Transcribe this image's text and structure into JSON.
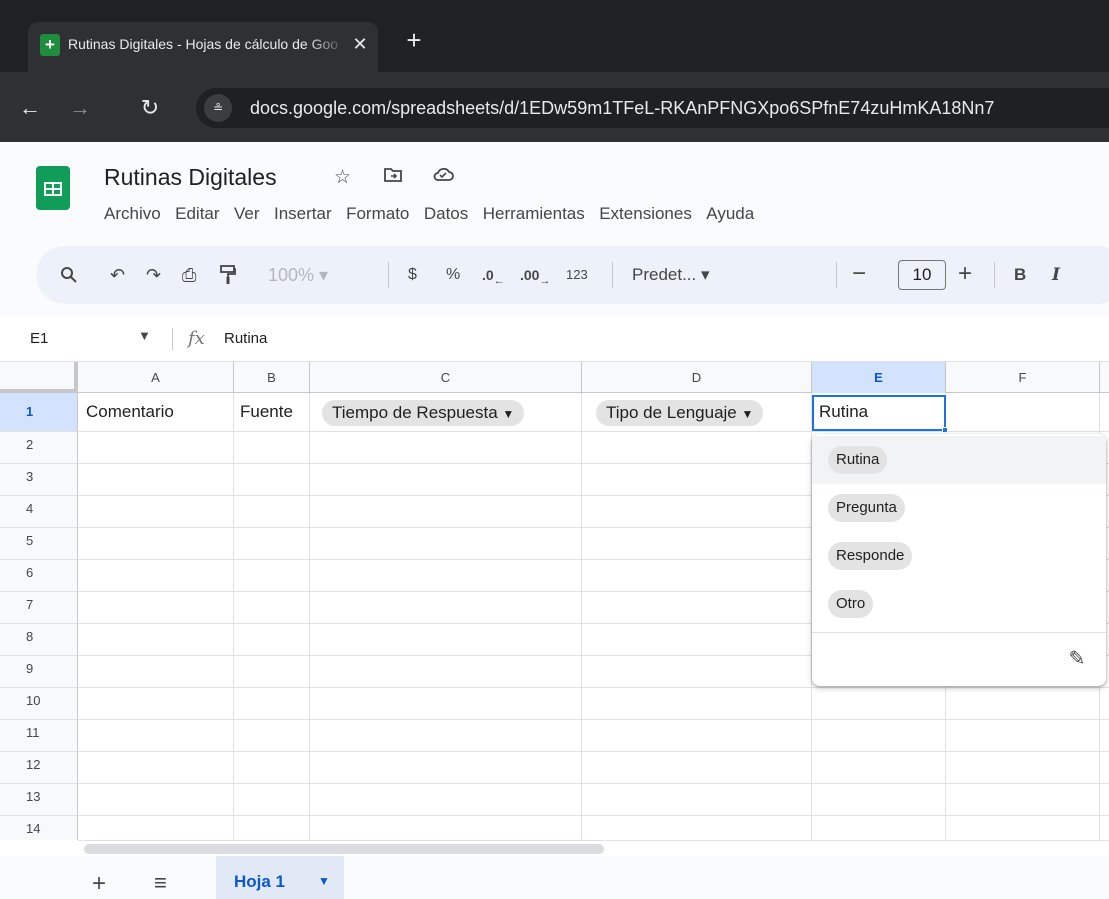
{
  "browser": {
    "tab_title": "Rutinas Digitales - Hojas de cálculo de Google",
    "tab_close": "✕",
    "new_tab": "+",
    "url": "docs.google.com/spreadsheets/d/1EDw59m1TFeL-RKAnPFNGXpo6SPfnE74zuHmKA18Nn7",
    "site_info_icon": "tune-icon"
  },
  "doc": {
    "title": "Rutinas Digitales",
    "menu": [
      "Archivo",
      "Editar",
      "Ver",
      "Insertar",
      "Formato",
      "Datos",
      "Herramientas",
      "Extensiones",
      "Ayuda"
    ]
  },
  "toolbar": {
    "zoom": "100%",
    "currency": "$",
    "percent": "%",
    "dec_decrease": ".0",
    "dec_increase": ".00",
    "number_format": "123",
    "font": "Predet...",
    "font_size": "10",
    "bold": "B",
    "italic": "I"
  },
  "formula_bar": {
    "name_box": "E1",
    "fx": "fx",
    "value": "Rutina"
  },
  "grid": {
    "columns": [
      "A",
      "B",
      "C",
      "D",
      "E",
      "F"
    ],
    "selected_column": "E",
    "rows": [
      "1",
      "2",
      "3",
      "4",
      "5",
      "6",
      "7",
      "8",
      "9",
      "10",
      "11",
      "12",
      "13",
      "14"
    ],
    "row1": {
      "A": "Comentario",
      "B": "Fuente",
      "C": "Tiempo de Respuesta",
      "D": "Tipo de Lenguaje",
      "E": "Rutina"
    }
  },
  "dropdown": {
    "options": [
      "Rutina",
      "Pregunta",
      "Responde",
      "Otro"
    ],
    "selected": "Rutina"
  },
  "sheets": {
    "active_tab": "Hoja 1"
  },
  "colors": {
    "accent": "#1a73e8",
    "sheets_green": "#0f9d58",
    "selected_header": "#d3e3fd"
  }
}
